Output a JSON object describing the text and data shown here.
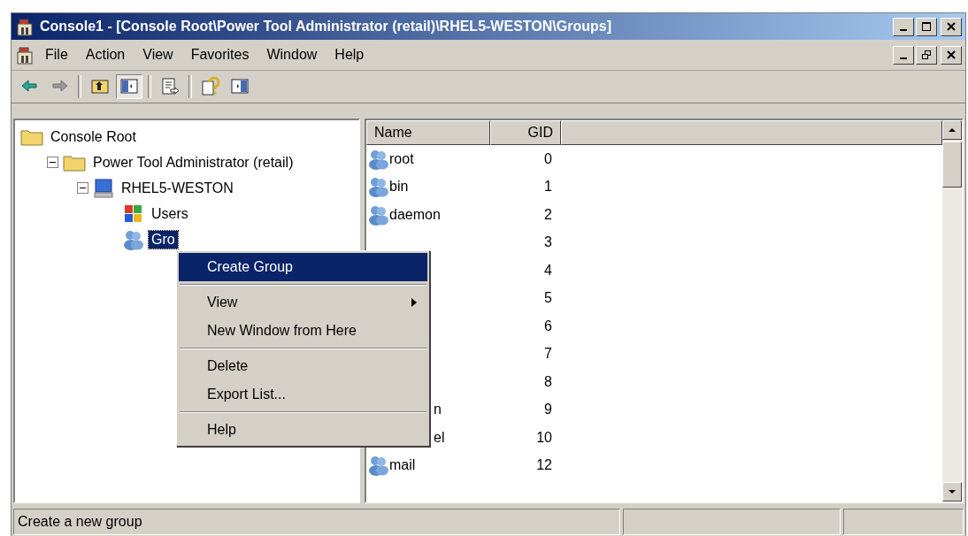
{
  "window": {
    "title": "Console1 - [Console Root\\Power Tool Administrator (retail)\\RHEL5-WESTON\\Groups]"
  },
  "menu_bar": [
    "File",
    "Action",
    "View",
    "Favorites",
    "Window",
    "Help"
  ],
  "toolbar": [
    {
      "kind": "back",
      "pressed": false
    },
    {
      "kind": "forward",
      "pressed": false
    },
    {
      "kind": "separator"
    },
    {
      "kind": "up",
      "pressed": false
    },
    {
      "kind": "tree",
      "pressed": true
    },
    {
      "kind": "separator"
    },
    {
      "kind": "export",
      "pressed": false
    },
    {
      "kind": "separator"
    },
    {
      "kind": "help",
      "pressed": false
    },
    {
      "kind": "pane",
      "pressed": false
    }
  ],
  "tree": [
    {
      "label": "Console Root",
      "kind": "folder",
      "selected": false,
      "children": [
        {
          "label": "Power Tool Administrator (retail)",
          "kind": "folder",
          "selected": false,
          "expanded": true,
          "children": [
            {
              "label": "RHEL5-WESTON",
              "kind": "computer",
              "selected": false,
              "expanded": true,
              "children": [
                {
                  "label": "Users",
                  "kind": "users",
                  "selected": false
                },
                {
                  "label": "Gro",
                  "kind": "group",
                  "selected": true
                }
              ]
            }
          ]
        }
      ]
    }
  ],
  "list": {
    "columns": [
      "Name",
      "GID"
    ],
    "rows": [
      {
        "name": "root",
        "kind": "group",
        "gid": "0"
      },
      {
        "name": "bin",
        "kind": "group",
        "gid": "1"
      },
      {
        "name": "daemon",
        "kind": "group",
        "gid": "2"
      },
      {
        "kind": "covered",
        "gid": "3"
      },
      {
        "kind": "covered",
        "gid": "4"
      },
      {
        "kind": "covered",
        "gid": "5"
      },
      {
        "kind": "covered",
        "gid": "6"
      },
      {
        "kind": "covered",
        "gid": "7"
      },
      {
        "kind": "covered",
        "gid": "8"
      },
      {
        "name": "n",
        "kind": "covered",
        "gid": "9"
      },
      {
        "name": "el",
        "kind": "covered",
        "gid": "10"
      },
      {
        "name": "mail",
        "kind": "group",
        "gid": "12"
      }
    ]
  },
  "context_menu": [
    {
      "kind": "item",
      "label": "Create Group",
      "selected": true,
      "submenu": false
    },
    {
      "kind": "separator"
    },
    {
      "kind": "item",
      "label": "View",
      "selected": false,
      "submenu": true
    },
    {
      "kind": "item",
      "label": "New Window from Here",
      "selected": false,
      "submenu": false
    },
    {
      "kind": "separator"
    },
    {
      "kind": "item",
      "label": "Delete",
      "selected": false,
      "submenu": false
    },
    {
      "kind": "item",
      "label": "Export List...",
      "selected": false,
      "submenu": false
    },
    {
      "kind": "separator"
    },
    {
      "kind": "item",
      "label": "Help",
      "selected": false,
      "submenu": false
    }
  ],
  "status_bar": [
    "Create a new group"
  ]
}
